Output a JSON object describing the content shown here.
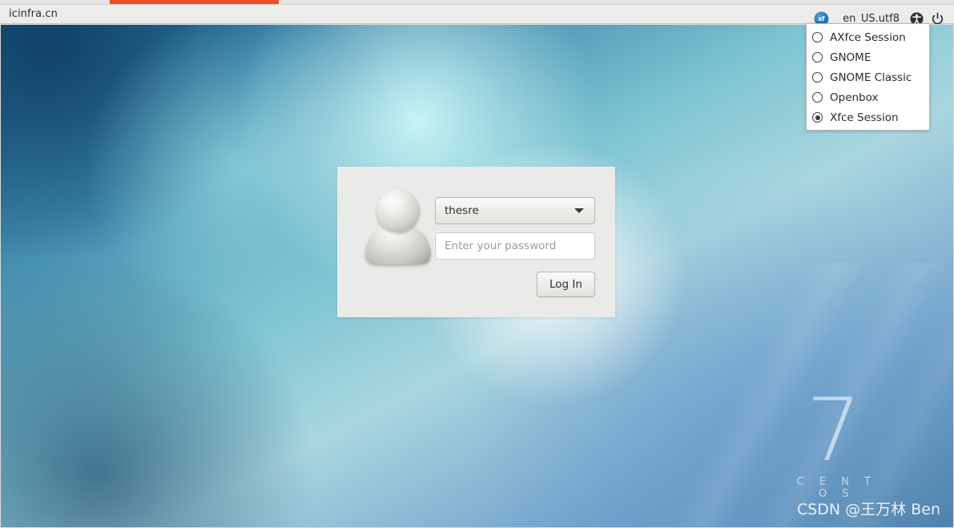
{
  "browser": {
    "page_title": "icinfra.cn",
    "tab_accent_color": "#e8502a"
  },
  "topbar": {
    "session_icon": "xfce-session-icon",
    "session_icon_label": "xf",
    "locale": "en_US.utf8",
    "accessibility_icon": "accessibility-icon",
    "power_icon": "power-icon"
  },
  "session_menu": {
    "items": [
      {
        "label": "AXfce Session",
        "selected": false
      },
      {
        "label": "GNOME",
        "selected": false
      },
      {
        "label": "GNOME Classic",
        "selected": false
      },
      {
        "label": "Openbox",
        "selected": false
      },
      {
        "label": "Xfce Session",
        "selected": true
      }
    ]
  },
  "login": {
    "avatar_icon": "user-avatar-icon",
    "username": "thesre",
    "password_value": "",
    "password_placeholder": "Enter your password",
    "login_label": "Log In"
  },
  "desktop": {
    "distro_version": "7",
    "distro_name": "C E N T O S",
    "watermark": "CSDN @王万林 Ben"
  }
}
